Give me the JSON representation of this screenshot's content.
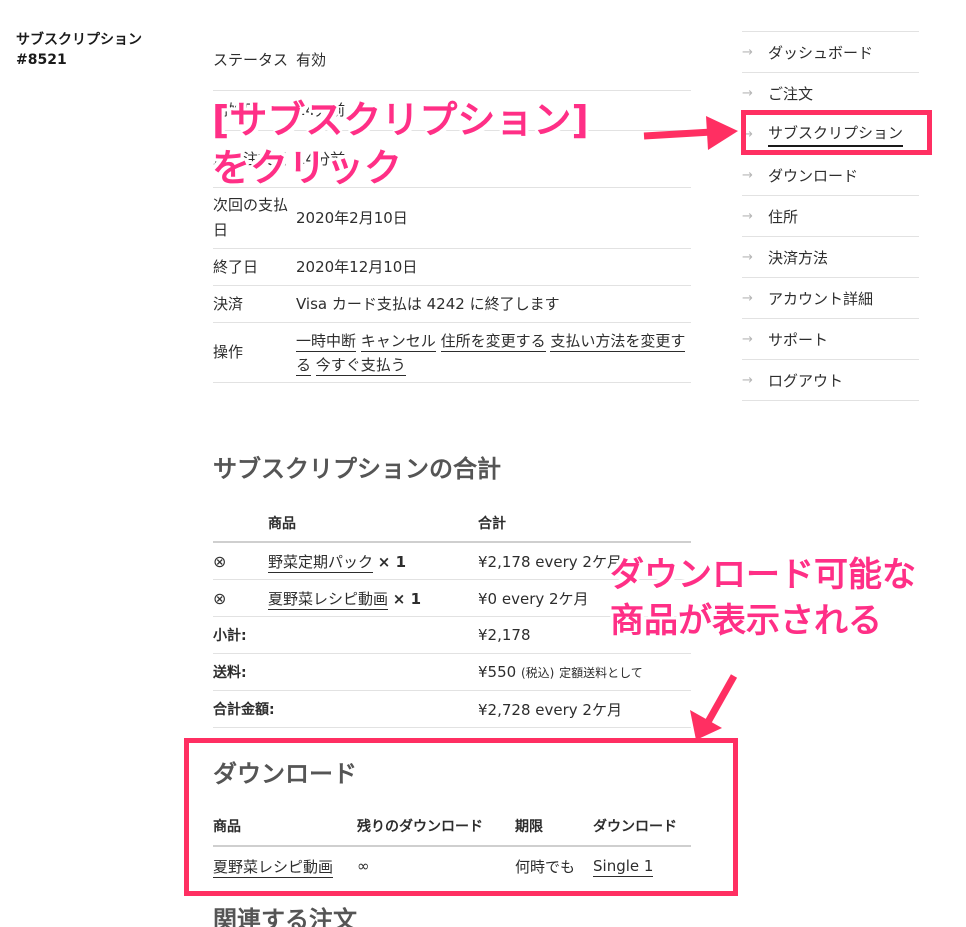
{
  "page": {
    "title_line1": "サブスクリプション",
    "title_line2": "#8521"
  },
  "details": [
    {
      "label": "ステータス",
      "value": "有効"
    },
    {
      "label": "開始日",
      "value": "14分前"
    },
    {
      "label": "最終注文日",
      "value": "14分前"
    },
    {
      "label": "次回の支払日",
      "value": "2020年2月10日"
    },
    {
      "label": "終了日",
      "value": "2020年12月10日"
    },
    {
      "label": "決済",
      "value": "Visa カード支払は 4242 に終了します"
    },
    {
      "label": "操作",
      "actions": [
        "一時中断",
        "キャンセル",
        "住所を変更する",
        "支払い方法を変更する",
        "今すぐ支払う"
      ]
    }
  ],
  "nav": {
    "items": [
      "ダッシュボード",
      "ご注文",
      "サブスクリプション",
      "ダウンロード",
      "住所",
      "決済方法",
      "アカウント詳細",
      "サポート",
      "ログアウト"
    ],
    "active": "サブスクリプション"
  },
  "totals": {
    "heading": "サブスクリプションの合計",
    "col_product": "商品",
    "col_total": "合計",
    "items": [
      {
        "remove_icon": "⊗",
        "name": "野菜定期パック",
        "qty": "× 1",
        "total": "¥2,178 every 2ケ月"
      },
      {
        "remove_icon": "⊗",
        "name": "夏野菜レシピ動画",
        "qty": "× 1",
        "total": "¥0 every 2ケ月"
      }
    ],
    "subtotal_label": "小計:",
    "subtotal_value": "¥2,178",
    "shipping_label": "送料:",
    "shipping_value": "¥550",
    "shipping_tax": "(税込)",
    "shipping_note": "定額送料として",
    "grand_label": "合計金額:",
    "grand_value": "¥2,728 every 2ケ月"
  },
  "downloads": {
    "heading": "ダウンロード",
    "cols": [
      "商品",
      "残りのダウンロード",
      "期限",
      "ダウンロード"
    ],
    "rows": [
      {
        "product": "夏野菜レシピ動画",
        "remaining": "∞",
        "expires": "何時でも",
        "download": "Single 1"
      }
    ]
  },
  "related": {
    "heading": "関連する注文"
  },
  "annotations": {
    "note1_line1": "[サブスクリプション]",
    "note1_line2": "をクリック",
    "note2_line1": "ダウンロード可能な",
    "note2_line2": "商品が表示される",
    "accent": "#ff2f86"
  }
}
